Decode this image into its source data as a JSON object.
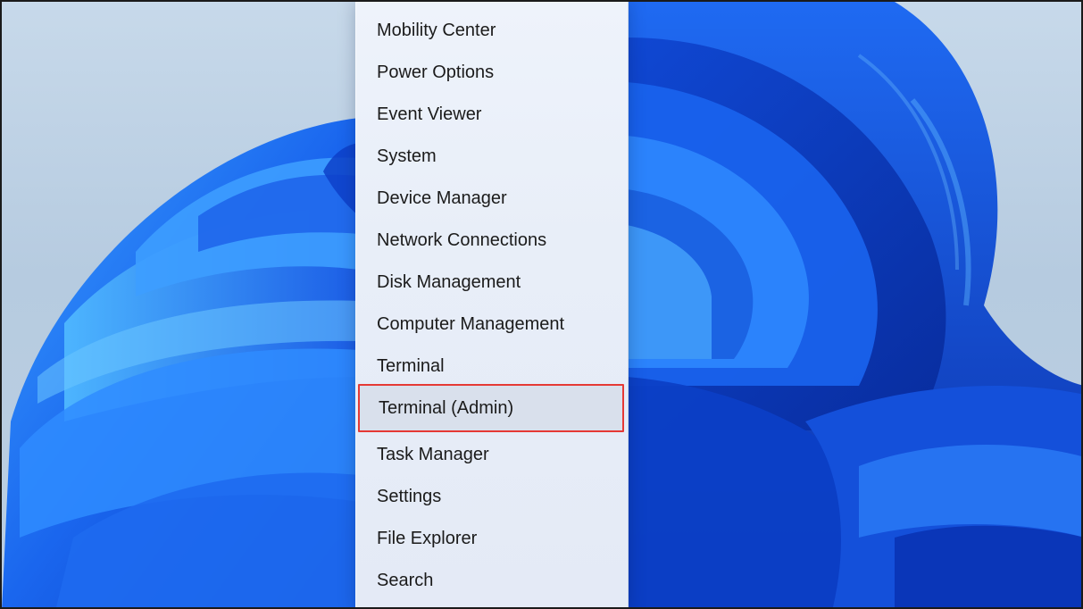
{
  "menu": {
    "items": [
      {
        "label": "Mobility Center"
      },
      {
        "label": "Power Options"
      },
      {
        "label": "Event Viewer"
      },
      {
        "label": "System"
      },
      {
        "label": "Device Manager"
      },
      {
        "label": "Network Connections"
      },
      {
        "label": "Disk Management"
      },
      {
        "label": "Computer Management"
      },
      {
        "label": "Terminal"
      },
      {
        "label": "Terminal (Admin)",
        "highlighted": true
      },
      {
        "label": "Task Manager"
      },
      {
        "label": "Settings"
      },
      {
        "label": "File Explorer"
      },
      {
        "label": "Search"
      }
    ]
  },
  "colors": {
    "highlight_border": "#e53935",
    "wallpaper_blue": "#1a5fe0",
    "menu_background": "#eaf0f9"
  }
}
